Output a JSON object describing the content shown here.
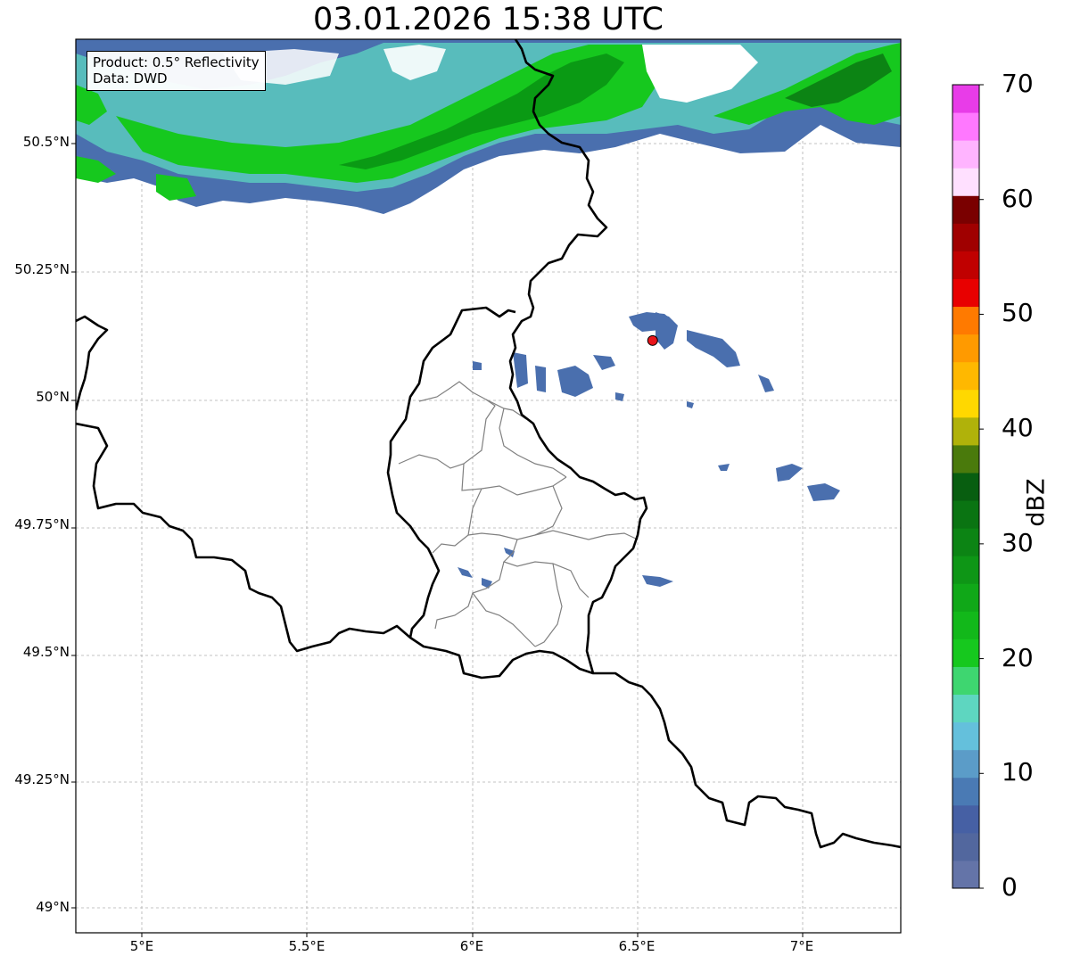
{
  "title": "03.01.2026 15:38 UTC",
  "info": {
    "product": "Product: 0.5° Reflectivity",
    "source": "Data: DWD"
  },
  "map": {
    "lat_ticks": [
      {
        "value": 50.5,
        "label": "50.5°N"
      },
      {
        "value": 50.25,
        "label": "50.25°N"
      },
      {
        "value": 50.0,
        "label": "50°N"
      },
      {
        "value": 49.75,
        "label": "49.75°N"
      },
      {
        "value": 49.5,
        "label": "49.5°N"
      },
      {
        "value": 49.25,
        "label": "49.25°N"
      },
      {
        "value": 49.0,
        "label": "49°N"
      }
    ],
    "lon_ticks": [
      {
        "value": 5.0,
        "label": "5°E"
      },
      {
        "value": 5.5,
        "label": "5.5°E"
      },
      {
        "value": 6.0,
        "label": "6°E"
      },
      {
        "value": 6.5,
        "label": "6.5°E"
      },
      {
        "value": 7.0,
        "label": "7°E"
      }
    ],
    "extent": {
      "lon_min": 4.8,
      "lon_max": 7.3,
      "lat_min": 48.95,
      "lat_max": 50.7
    },
    "radar_site": {
      "lon": 6.548,
      "lat": 50.11,
      "color": "#e8141a"
    },
    "grid": true
  },
  "colorbar": {
    "label": "dBZ",
    "min": 0,
    "max": 70,
    "tick_values": [
      0,
      10,
      20,
      30,
      40,
      50,
      60,
      70
    ],
    "colors": [
      "#6474a8",
      "#52679e",
      "#4660a4",
      "#4a7ab4",
      "#5b9cc8",
      "#64c0dc",
      "#5ed6c0",
      "#3ed670",
      "#16c81e",
      "#12b81a",
      "#10a818",
      "#0e9616",
      "#0c8414",
      "#0a7412",
      "#085e10",
      "#4a7a0c",
      "#b0b20a",
      "#ffd800",
      "#ffb800",
      "#ff9a00",
      "#ff7a00",
      "#e80000",
      "#c00000",
      "#a00000",
      "#7a0000",
      "#ffe0ff",
      "#ffb4ff",
      "#ff78ff",
      "#e83ce8"
    ]
  }
}
